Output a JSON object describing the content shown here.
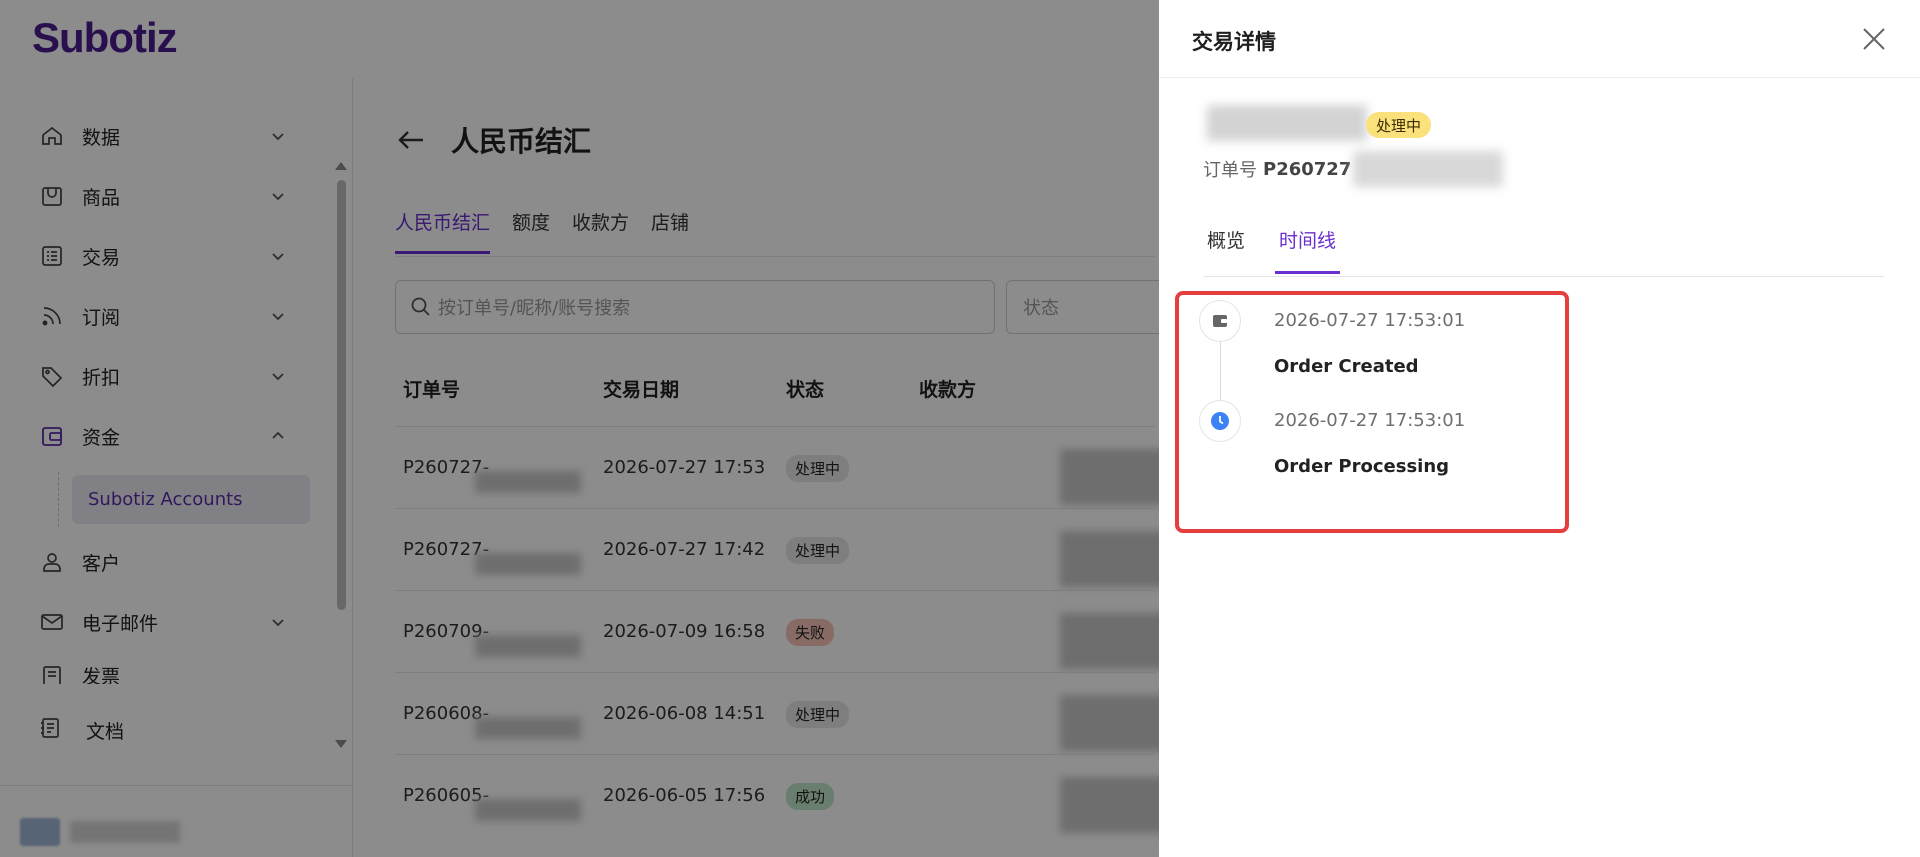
{
  "app": {
    "logo": "Subotiz"
  },
  "sidebar": {
    "items": [
      {
        "label": "数据",
        "icon": "home-icon"
      },
      {
        "label": "商品",
        "icon": "store-icon"
      },
      {
        "label": "交易",
        "icon": "list-icon"
      },
      {
        "label": "订阅",
        "icon": "rss-icon"
      },
      {
        "label": "折扣",
        "icon": "tag-icon"
      },
      {
        "label": "资金",
        "icon": "wallet-icon",
        "expanded": true
      },
      {
        "label": "客户",
        "icon": "user-icon"
      },
      {
        "label": "电子邮件",
        "icon": "mail-icon"
      },
      {
        "label": "发票",
        "icon": "invoice-icon"
      }
    ],
    "sub_item": "Subotiz Accounts",
    "docs": "文档"
  },
  "main": {
    "title": "人民币结汇",
    "tabs": [
      "人民币结汇",
      "额度",
      "收款方",
      "店铺"
    ],
    "search_placeholder": "按订单号/昵称/账号搜索",
    "status_placeholder": "状态",
    "columns": [
      "订单号",
      "交易日期",
      "状态",
      "收款方"
    ],
    "rows": [
      {
        "id": "P260727-",
        "date": "2026-07-27 17:53",
        "status": "处理中",
        "status_color": "#e6e6e6"
      },
      {
        "id": "P260727-",
        "date": "2026-07-27 17:42",
        "status": "处理中",
        "status_color": "#e6e6e6"
      },
      {
        "id": "P260709-",
        "date": "2026-07-09 16:58",
        "status": "失败",
        "status_color": "#f8c4b8"
      },
      {
        "id": "P260608-",
        "date": "2026-06-08 14:51",
        "status": "处理中",
        "status_color": "#e6e6e6"
      },
      {
        "id": "P260605-",
        "date": "2026-06-05 17:56",
        "status": "成功",
        "status_color": "#bfe5c8"
      }
    ]
  },
  "drawer": {
    "title": "交易详情",
    "status": "处理中",
    "order_label": "订单号",
    "order_prefix": "P260727",
    "tabs": [
      "概览",
      "时间线"
    ],
    "active_tab": "时间线",
    "timeline": [
      {
        "time": "2026-07-27 17:53:01",
        "event": "Order Created",
        "icon": "wallet-icon"
      },
      {
        "time": "2026-07-27 17:53:01",
        "event": "Order Processing",
        "icon": "clock-icon"
      }
    ]
  },
  "colors": {
    "brand": "#4b1d8f",
    "accent": "#6a2fd0",
    "highlight": "#e53e3e",
    "pending": "#fbe17b"
  }
}
